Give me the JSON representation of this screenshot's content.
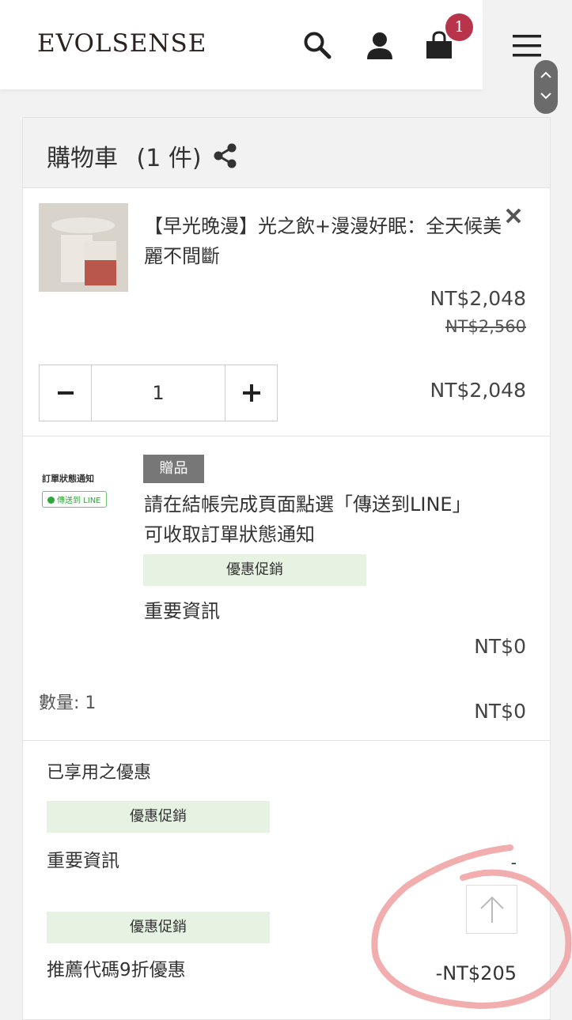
{
  "header": {
    "logo": "EVOLSENSE",
    "cart_count": "1",
    "icons": [
      "search-icon",
      "user-icon",
      "shopping-bag-icon",
      "menu-icon"
    ]
  },
  "cart": {
    "title": "購物車",
    "count": "(1 件)",
    "item": {
      "name": "【早光晚漫】光之飲+漫漫好眠：全天候美麗不間斷",
      "price": "NT$2,048",
      "original_price": "NT$2,560",
      "quantity": "1",
      "line_total": "NT$2,048"
    },
    "gift": {
      "thumb_title": "訂單狀態通知",
      "thumb_tag": "傳送到 LINE",
      "badge": "贈品",
      "description": "請在結帳完成頁面點選「傳送到LINE」可收取訂單狀態通知",
      "promo_tag": "優惠促銷",
      "info": "重要資訊",
      "price": "NT$0",
      "quantity_label": "數量: 1",
      "total": "NT$0"
    }
  },
  "applied": {
    "title": "已享用之優惠",
    "promotions": [
      {
        "tag": "優惠促銷",
        "label": "重要資訊",
        "value": "-"
      },
      {
        "tag": "優惠促銷",
        "label": "推薦代碼9折優惠",
        "value": "-NT$205"
      }
    ]
  },
  "colors": {
    "badge": "#b8344b",
    "promo_tag_bg": "#e6f2e2",
    "gift_badge_bg": "#777777",
    "annotation": "#f0a0a0"
  }
}
